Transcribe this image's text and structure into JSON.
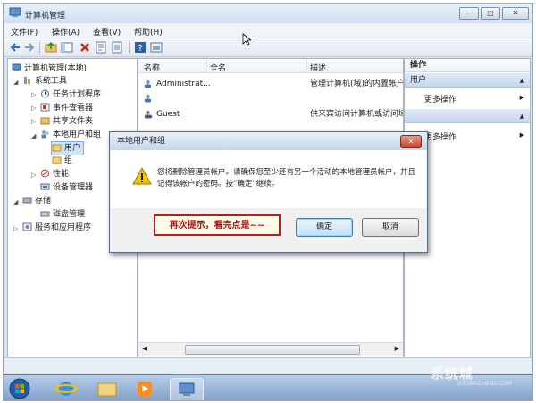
{
  "window": {
    "title": "计算机管理",
    "buttons": [
      "—",
      "□",
      "✕"
    ]
  },
  "menu": [
    "文件(F)",
    "操作(A)",
    "查看(V)",
    "帮助(H)"
  ],
  "tree": {
    "root": "计算机管理(本地)",
    "system_tools": "系统工具",
    "task_scheduler": "任务计划程序",
    "event_viewer": "事件查看器",
    "shared_folders": "共享文件夹",
    "local_users_groups": "本地用户和组",
    "users": "用户",
    "groups": "组",
    "performance": "性能",
    "device_manager": "设备管理器",
    "storage": "存储",
    "disk_management": "磁盘管理",
    "services_apps": "服务和应用程序"
  },
  "list": {
    "columns": [
      "名称",
      "全名",
      "描述"
    ],
    "rows": [
      {
        "name": "Administrat...",
        "fullname": "",
        "desc": "管理计算机(域)的内置帐户"
      },
      {
        "name": "",
        "fullname": "",
        "desc": ""
      },
      {
        "name": "Guest",
        "fullname": "",
        "desc": "供来宾访问计算机或访问域"
      }
    ]
  },
  "actions": {
    "header": "操作",
    "section1": "用户",
    "more1": "更多操作",
    "more2": "更多操作"
  },
  "dialog": {
    "title": "本地用户和组",
    "close": "✕",
    "message": "您将删除管理员帐户。请确保您至少还有另一个活动的本地管理员帐户，并且记得该帐户的密码。按“确定”继续。",
    "ok": "确定",
    "cancel": "取消"
  },
  "callout": "再次提示，看完点是~~",
  "watermark": {
    "main": "系统城",
    "sub": "XITONGCHENG.COM"
  },
  "colors": {
    "accent": "#3c7fb1",
    "callout_border": "#b02020",
    "warning": "#f2c200"
  }
}
